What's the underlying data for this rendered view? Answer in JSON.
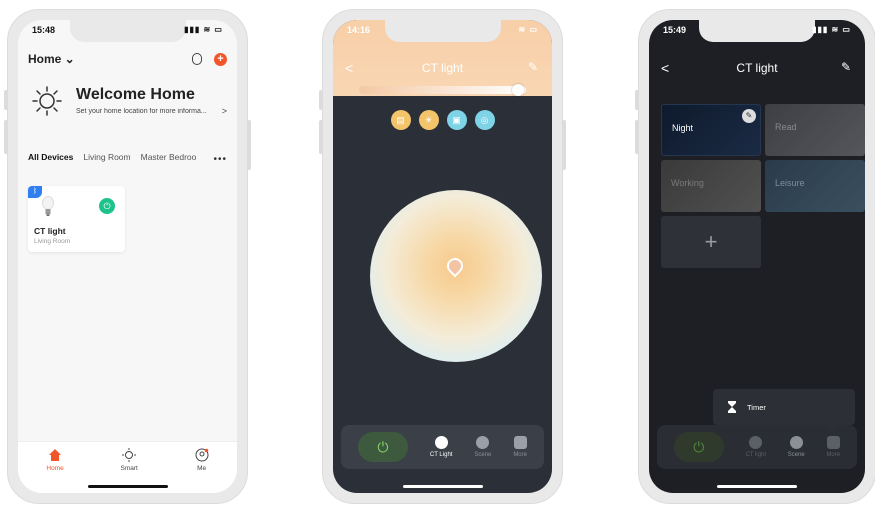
{
  "phone1": {
    "status": {
      "time": "15:48",
      "signal": "▮▮▮ ≋ ▭"
    },
    "header": {
      "home_label": "Home ⌄"
    },
    "welcome": {
      "title": "Welcome Home",
      "subtitle": "Set your home location for more informa...",
      "arrow": ">"
    },
    "tabs": [
      "All Devices",
      "Living Room",
      "Master Bedroo"
    ],
    "tab_more": "•••",
    "device": {
      "name": "CT light",
      "room": "Living Room",
      "badge": "ᛒ"
    },
    "tabbar": [
      {
        "label": "Home",
        "icon": "home-icon"
      },
      {
        "label": "Smart",
        "icon": "sun-icon"
      },
      {
        "label": "Me",
        "icon": "profile-icon"
      }
    ],
    "accent": "#f1552a"
  },
  "phone2": {
    "status": {
      "time": "14:16",
      "signal": "≋ ▭"
    },
    "title": "CT light",
    "back": "<",
    "edit": "✎",
    "modes": [
      {
        "icon": "reading-icon",
        "color": "#f4c46a"
      },
      {
        "icon": "sun-icon",
        "color": "#f4c46a"
      },
      {
        "icon": "image-icon",
        "color": "#7fd3e6"
      },
      {
        "icon": "night-icon",
        "color": "#7fd3e6"
      }
    ],
    "brightness_level": 0.95,
    "controls": [
      {
        "label": "CT Light",
        "icon": "bulb-icon",
        "active": true
      },
      {
        "label": "Scene",
        "icon": "scene-icon",
        "active": false
      },
      {
        "label": "More",
        "icon": "grid-icon",
        "active": false
      }
    ],
    "power_symbol": "⏻"
  },
  "phone3": {
    "status": {
      "time": "15:49",
      "signal": "▮▮▮ ≋ ▭"
    },
    "title": "CT light",
    "back": "<",
    "edit": "✎",
    "scenes": [
      {
        "label": "Night",
        "style": "night",
        "editable": true
      },
      {
        "label": "Read",
        "style": "read"
      },
      {
        "label": "Working",
        "style": "working"
      },
      {
        "label": "Leisure",
        "style": "leisure"
      },
      {
        "label": "+",
        "style": "add"
      }
    ],
    "timer_label": "Timer",
    "controls": [
      {
        "label": "CT light",
        "icon": "bulb-icon",
        "active": false
      },
      {
        "label": "Scene",
        "icon": "scene-icon",
        "active": true
      },
      {
        "label": "More",
        "icon": "grid-icon",
        "active": false
      }
    ],
    "power_symbol": "⏻"
  }
}
